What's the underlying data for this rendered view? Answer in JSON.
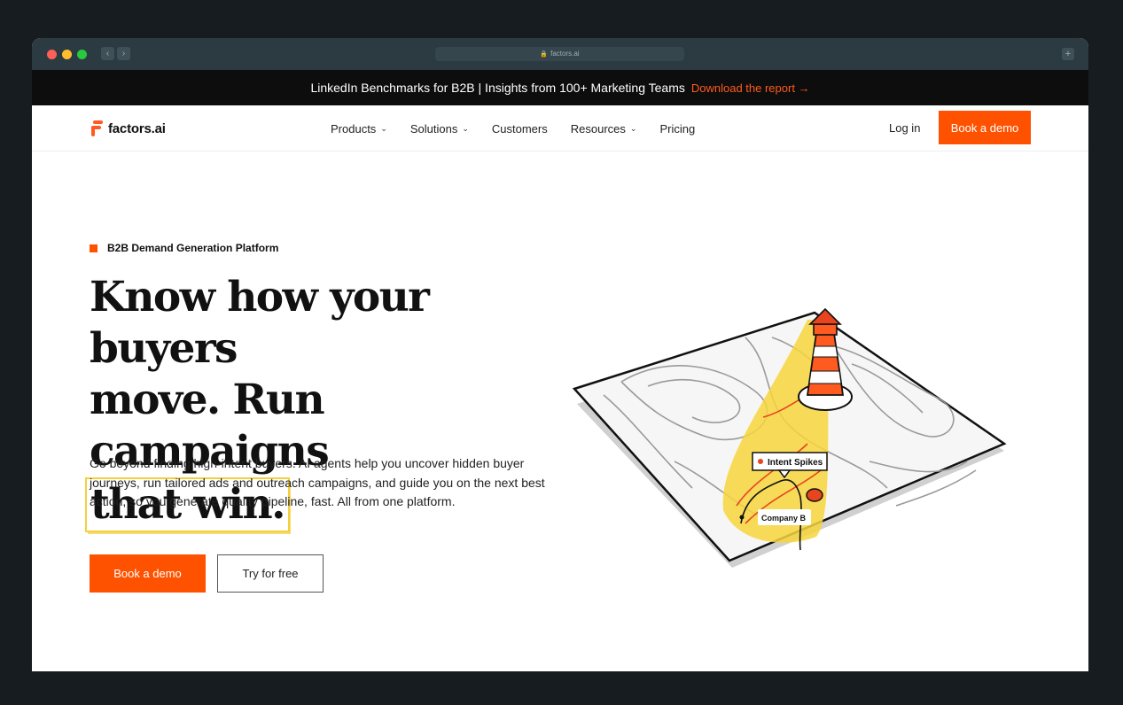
{
  "browser": {
    "url": "factors.ai"
  },
  "announcement": {
    "text": "LinkedIn Benchmarks for B2B | Insights from 100+ Marketing Teams",
    "link": "Download the report →"
  },
  "nav": {
    "logo": "factors.ai",
    "items": [
      {
        "label": "Products",
        "dropdown": true
      },
      {
        "label": "Solutions",
        "dropdown": true
      },
      {
        "label": "Customers",
        "dropdown": false
      },
      {
        "label": "Resources",
        "dropdown": true
      },
      {
        "label": "Pricing",
        "dropdown": false
      }
    ],
    "login": "Log in",
    "cta": "Book a demo"
  },
  "hero": {
    "eyebrow": "B2B Demand Generation Platform",
    "headline_line1": "Know how your buyers",
    "headline_line2": "move. Run campaigns",
    "headline_highlight": "that win.",
    "description": "Go beyond finding high-intent buyers. AI agents help you uncover hidden buyer journeys, run tailored ads and outreach campaigns, and guide you on the next best action, so you generate quality pipeline, fast. All from one platform.",
    "primary_cta": "Book a demo",
    "secondary_cta": "Try for free"
  },
  "illustration": {
    "label_intent": "Intent Spikes",
    "label_company": "Company B"
  },
  "colors": {
    "accent": "#ff5200",
    "highlight": "#f4d03f",
    "chrome": "#2c3b41",
    "announcement_bg": "#0d0d0d"
  }
}
